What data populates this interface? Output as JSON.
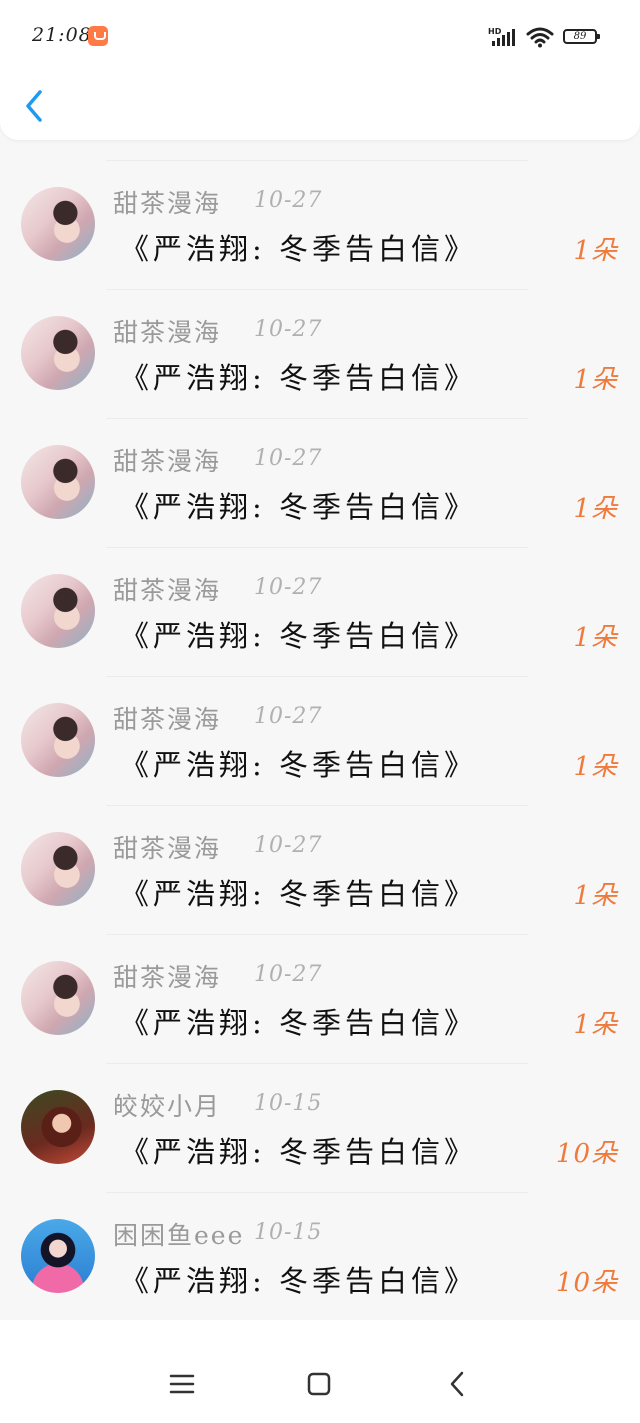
{
  "status_bar": {
    "time": "21:08",
    "network_label": "HD",
    "battery": "89",
    "app_badge_icon": "shopping-bag-icon"
  },
  "header": {
    "back_icon": "chevron-left-icon",
    "accent_color": "#1e9bf0"
  },
  "items": [
    {
      "name": "甜茶漫海",
      "date": "10-27",
      "title": "《严浩翔: 冬季告白信》",
      "count": "1朵",
      "avatar": "a1"
    },
    {
      "name": "甜茶漫海",
      "date": "10-27",
      "title": "《严浩翔: 冬季告白信》",
      "count": "1朵",
      "avatar": "a1"
    },
    {
      "name": "甜茶漫海",
      "date": "10-27",
      "title": "《严浩翔: 冬季告白信》",
      "count": "1朵",
      "avatar": "a1"
    },
    {
      "name": "甜茶漫海",
      "date": "10-27",
      "title": "《严浩翔: 冬季告白信》",
      "count": "1朵",
      "avatar": "a1"
    },
    {
      "name": "甜茶漫海",
      "date": "10-27",
      "title": "《严浩翔: 冬季告白信》",
      "count": "1朵",
      "avatar": "a1"
    },
    {
      "name": "甜茶漫海",
      "date": "10-27",
      "title": "《严浩翔: 冬季告白信》",
      "count": "1朵",
      "avatar": "a1"
    },
    {
      "name": "甜茶漫海",
      "date": "10-27",
      "title": "《严浩翔: 冬季告白信》",
      "count": "1朵",
      "avatar": "a1"
    },
    {
      "name": "皎姣小月",
      "date": "10-15",
      "title": "《严浩翔: 冬季告白信》",
      "count": "10朵",
      "avatar": "a2"
    },
    {
      "name": "困困鱼eee",
      "date": "10-15",
      "title": "《严浩翔: 冬季告白信》",
      "count": "10朵",
      "avatar": "a3"
    }
  ],
  "nav_bar": {
    "menu_icon": "menu-icon",
    "home_icon": "home-square-icon",
    "back_icon": "back-triangle-icon"
  },
  "colors": {
    "count": "#ee7a3c",
    "name": "#9a9a9a",
    "title": "#111111"
  }
}
